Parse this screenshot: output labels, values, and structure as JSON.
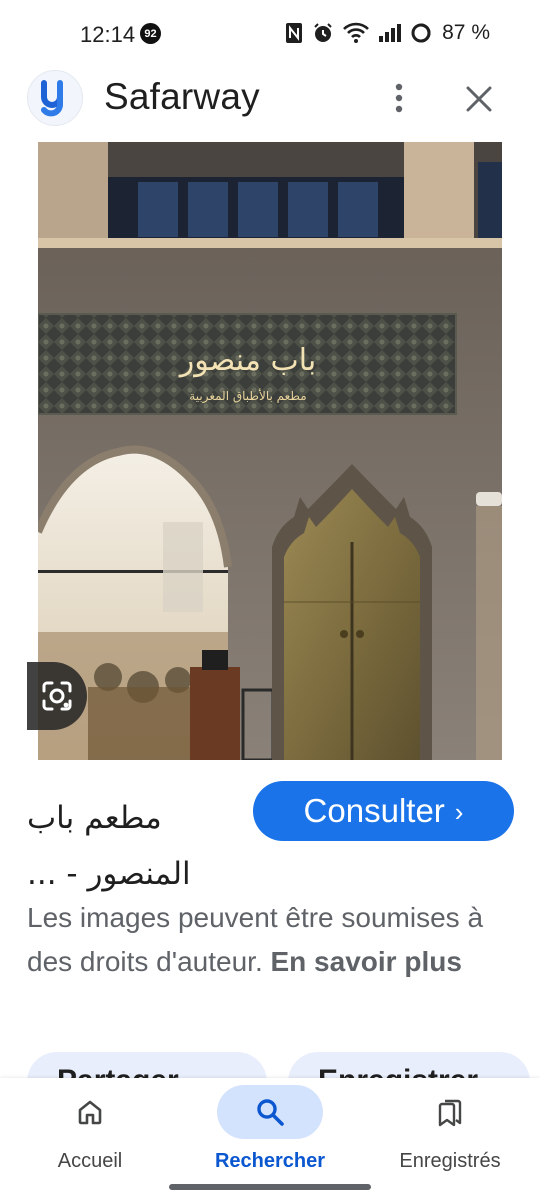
{
  "status_bar": {
    "time": "12:14",
    "notification_count": "92",
    "battery": "87 %",
    "icons": [
      "nfc-icon",
      "alarm-icon",
      "wifi-icon",
      "signal-icon",
      "battery-icon"
    ]
  },
  "header": {
    "app_name": "Safarway",
    "logo_letter": "y",
    "accent": "#1a73e8"
  },
  "photo": {
    "sign_title": "باب منصور",
    "sign_subtitle": "مطعم بالأطباق المغربية"
  },
  "result": {
    "title": "مطعم باب المنصور - ...",
    "consult_label": "Consulter",
    "consult_chevron": "›",
    "disclaimer": "Les images peuvent être soumises à des droits d'auteur.",
    "learn_more": "En savoir plus"
  },
  "actions": {
    "share_label": "Partager",
    "save_label": "Enregistrer"
  },
  "bottom_nav": {
    "items": [
      {
        "label": "Accueil",
        "icon": "home-icon",
        "active": false
      },
      {
        "label": "Rechercher",
        "icon": "search-icon",
        "active": true
      },
      {
        "label": "Enregistrés",
        "icon": "saved-icon",
        "active": false
      }
    ]
  },
  "colors": {
    "primary_blue": "#1a73e8",
    "nav_active_pill": "#d3e3fd",
    "nav_active_text": "#0b57d0",
    "chip_bg": "#e8eefb"
  }
}
